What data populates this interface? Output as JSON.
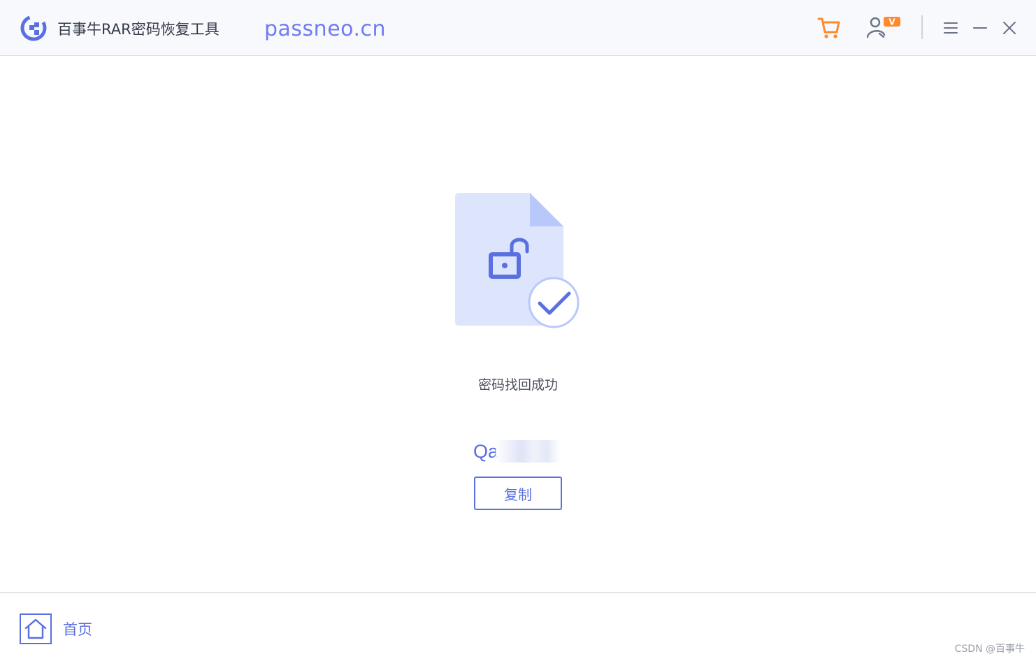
{
  "app": {
    "title": "百事牛RAR密码恢复工具",
    "watermark_url": "passneo.cn"
  },
  "titlebar": {
    "icons": [
      "cart-icon",
      "user-vip-icon",
      "menu-icon",
      "minimize-icon",
      "close-icon"
    ],
    "vip_badge": "V"
  },
  "result": {
    "status": "密码找回成功",
    "password_visible": "Qa",
    "copy_label": "复制"
  },
  "footer": {
    "home_label": "首页",
    "watermark": "CSDN @百事牛"
  },
  "colors": {
    "accent": "#5a6fe0",
    "cart_orange": "#ff8a2b",
    "file_bg": "#dde5fd",
    "file_fold": "#b9c8fb"
  }
}
